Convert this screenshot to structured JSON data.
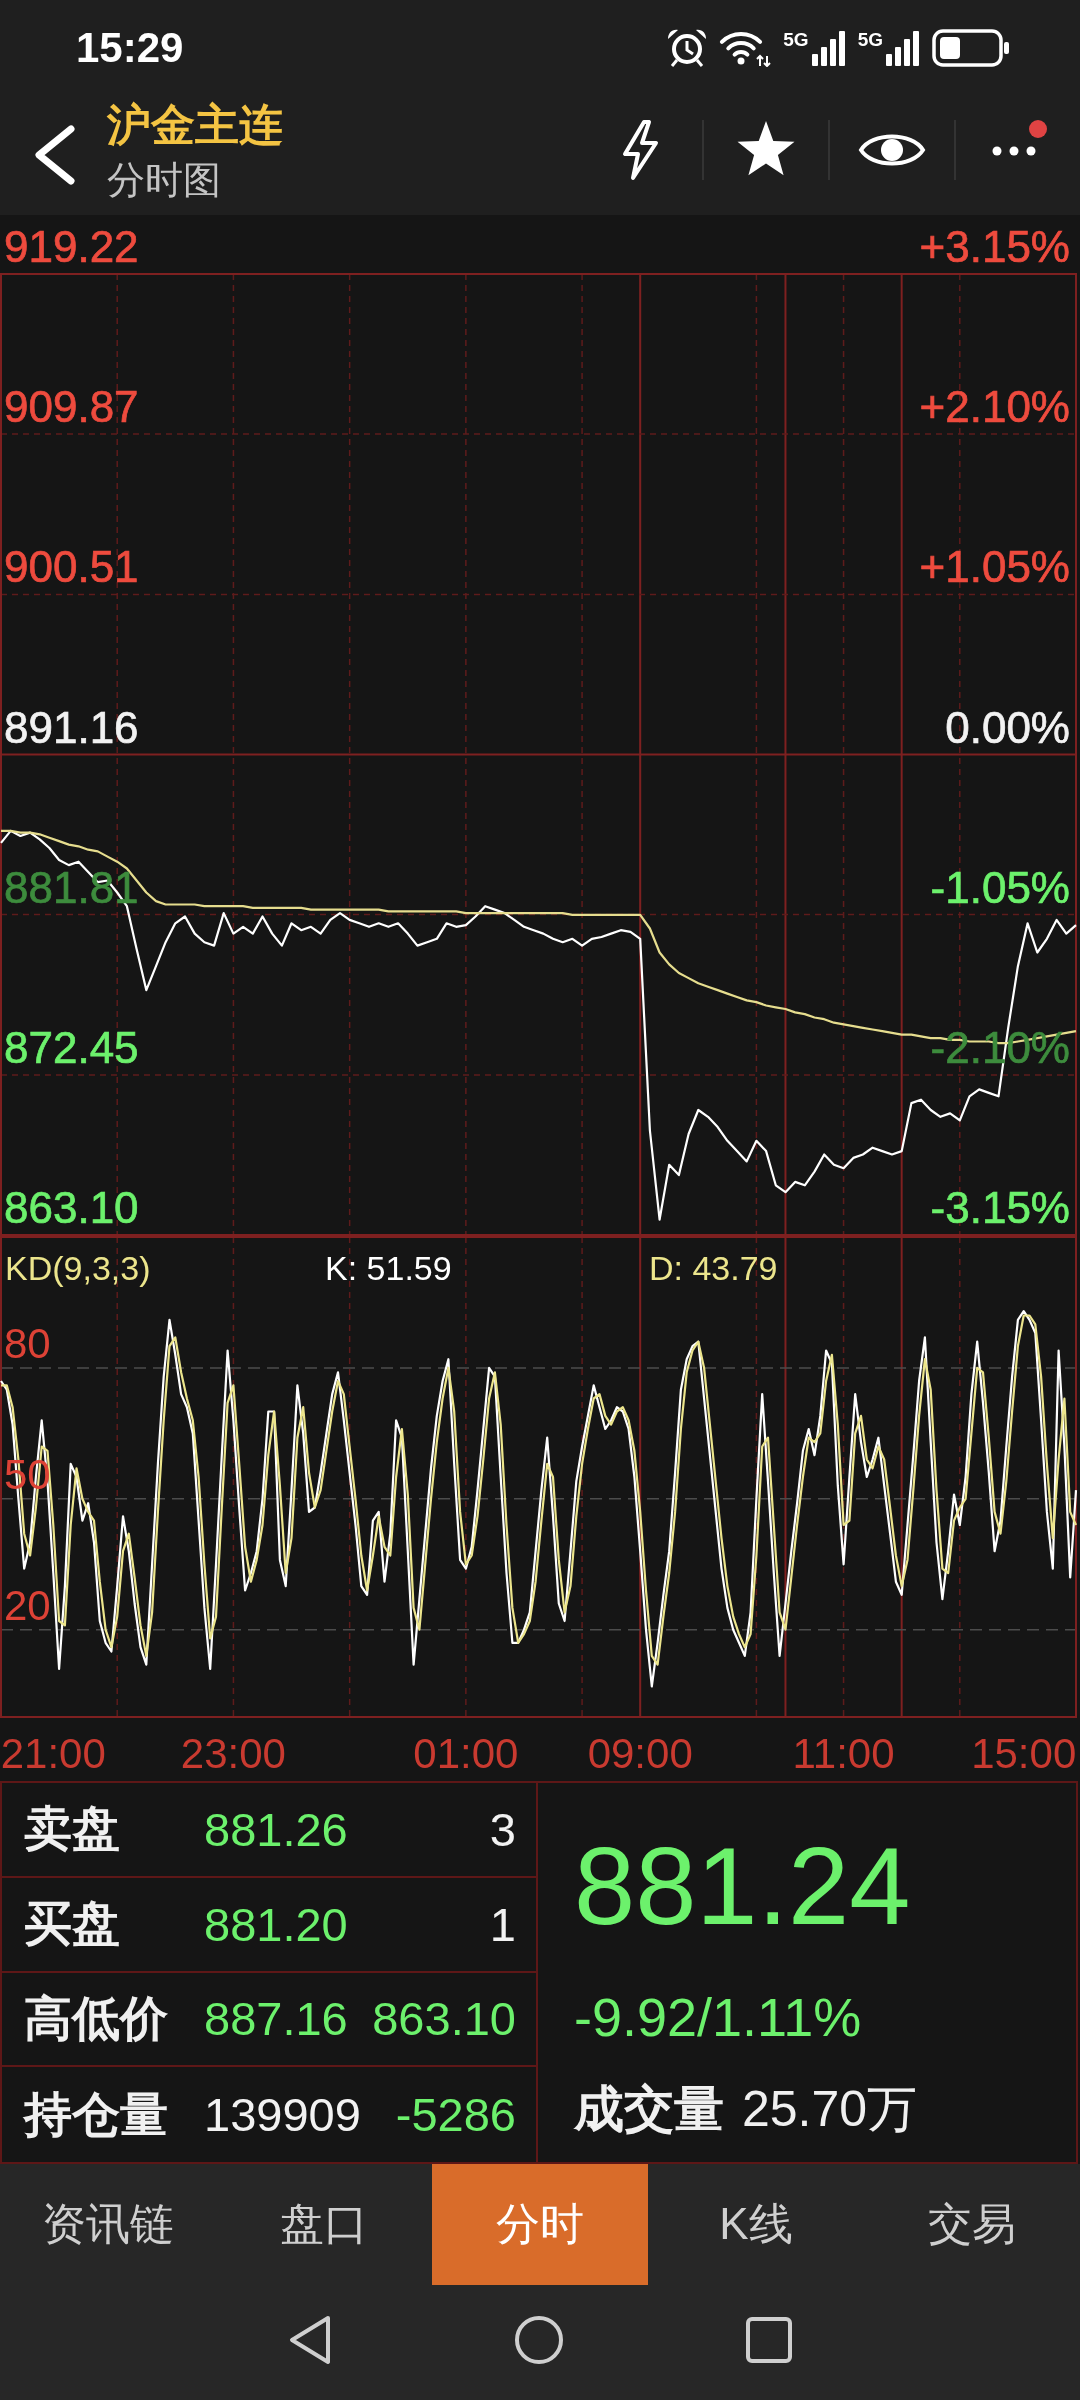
{
  "status_bar": {
    "time": "15:29",
    "networks": [
      {
        "label": "5G"
      },
      {
        "label": "5G"
      }
    ]
  },
  "header": {
    "title": "沪金主连",
    "subtitle": "分时图",
    "more_badge": true
  },
  "price_chart": {
    "scale": [
      {
        "left": {
          "color": "#ee4b3e"
        },
        "right": {
          "text": "+3.15%",
          "color": "#ee4b3e"
        }
      },
      {
        "left": {
          "color": "#ee4b3e"
        },
        "right": {
          "text": "+2.10%",
          "color": "#ee4b3e"
        }
      },
      {
        "left": {
          "color": "#ee4b3e"
        },
        "right": {
          "text": "+1.05%",
          "color": "#ee4b3e"
        }
      },
      {
        "left": {
          "color": "#f2f2f2"
        },
        "right": {
          "text": "0.00%",
          "color": "#f2f2f2"
        }
      },
      {
        "left": {
          "color": "#3d8c3d"
        },
        "right": {
          "text": "-1.05%",
          "color": "#6cf16c"
        }
      },
      {
        "left": {
          "color": "#6cf16c"
        },
        "right": {
          "text": "-2.10%",
          "color": "#3d8c3d"
        }
      },
      {
        "left": {
          "color": "#6cf16c"
        },
        "right": {
          "text": "-3.15%",
          "color": "#6cf16c"
        }
      }
    ],
    "chart_data": {
      "type": "line",
      "grid": true,
      "ylim": [
        863.1,
        919.22
      ],
      "yticks": [
        {
          "value": 919.22,
          "label": "919.22"
        },
        {
          "value": 909.87,
          "label": "909.87"
        },
        {
          "value": 900.51,
          "label": "900.51"
        },
        {
          "value": 891.16,
          "label": "891.16"
        },
        {
          "value": 881.81,
          "label": "881.81"
        },
        {
          "value": 872.45,
          "label": "872.45"
        },
        {
          "value": 863.1,
          "label": "863.10"
        }
      ],
      "categories": [
        null,
        null,
        null,
        null,
        null,
        null,
        null,
        null,
        null,
        null,
        null,
        null,
        null,
        null,
        null,
        null,
        null,
        null,
        null,
        null,
        null,
        null,
        null,
        null,
        null,
        null,
        null,
        null,
        null,
        null,
        null,
        null,
        null,
        null,
        null,
        null,
        null,
        null,
        null,
        null,
        null,
        null,
        null,
        null,
        null,
        null,
        null,
        null,
        null,
        null,
        null,
        null,
        null,
        null,
        null,
        null,
        null,
        null,
        null,
        null,
        null,
        null,
        null,
        null,
        null,
        null,
        null,
        null,
        null,
        null,
        null,
        null,
        null,
        null,
        null,
        null,
        null,
        null,
        null,
        null,
        null,
        null,
        null,
        null,
        null,
        null,
        null,
        null,
        null,
        null,
        null,
        null,
        null,
        null,
        null,
        null,
        null,
        null,
        null,
        null,
        null,
        null,
        null,
        null,
        null,
        null,
        null,
        null,
        null,
        null,
        null,
        null
      ],
      "series": [
        {
          "color": "#ffffff",
          "values": [
            886.0,
            886.7,
            886.4,
            886.6,
            886.2,
            885.7,
            885.0,
            884.7,
            884.9,
            884.3,
            883.7,
            883.8,
            883.1,
            882.3,
            879.8,
            877.4,
            878.8,
            880.2,
            881.3,
            881.7,
            880.7,
            880.2,
            880.0,
            881.9,
            880.7,
            881.1,
            880.7,
            881.7,
            880.7,
            880.0,
            881.3,
            880.9,
            881.1,
            880.7,
            881.5,
            881.9,
            881.5,
            881.3,
            881.1,
            881.3,
            881.1,
            881.3,
            880.7,
            880.0,
            880.2,
            880.4,
            881.3,
            881.1,
            881.2,
            881.7,
            882.3,
            882.1,
            881.9,
            881.5,
            881.1,
            880.9,
            880.7,
            880.4,
            880.2,
            880.4,
            880.0,
            880.4,
            880.5,
            880.7,
            880.9,
            880.8,
            880.4,
            869.2,
            864.0,
            867.2,
            866.6,
            869.0,
            870.4,
            870.0,
            869.4,
            868.6,
            868.0,
            867.4,
            868.6,
            868.0,
            866.0,
            865.6,
            866.2,
            866.0,
            866.8,
            867.8,
            867.2,
            867.0,
            867.6,
            867.8,
            868.2,
            868.0,
            867.8,
            868.0,
            870.8,
            871.0,
            870.4,
            870.0,
            870.2,
            869.8,
            871.2,
            871.6,
            871.4,
            871.2,
            875.2,
            878.8,
            881.3,
            879.6,
            880.4,
            881.5,
            880.7,
            881.2
          ]
        },
        {
          "color": "#e6dd8e",
          "values": [
            886.7,
            886.7,
            886.6,
            886.6,
            886.5,
            886.3,
            886.1,
            885.9,
            885.8,
            885.6,
            885.5,
            885.2,
            884.9,
            884.5,
            883.8,
            883.1,
            882.6,
            882.4,
            882.4,
            882.4,
            882.4,
            882.3,
            882.3,
            882.3,
            882.3,
            882.3,
            882.2,
            882.2,
            882.2,
            882.2,
            882.2,
            882.2,
            882.1,
            882.1,
            882.1,
            882.1,
            882.1,
            882.1,
            882.1,
            882.1,
            882.0,
            882.0,
            882.0,
            882.0,
            882.0,
            882.0,
            882.0,
            882.0,
            881.9,
            881.9,
            881.9,
            881.9,
            881.9,
            881.9,
            881.9,
            881.9,
            881.9,
            881.9,
            881.9,
            881.8,
            881.8,
            881.8,
            881.8,
            881.8,
            881.8,
            881.8,
            881.8,
            881.0,
            879.6,
            878.9,
            878.4,
            878.1,
            877.8,
            877.6,
            877.4,
            877.2,
            877.0,
            876.8,
            876.7,
            876.5,
            876.4,
            876.3,
            876.1,
            876.0,
            875.8,
            875.7,
            875.5,
            875.4,
            875.3,
            875.2,
            875.1,
            875.0,
            874.9,
            874.8,
            874.8,
            874.7,
            874.6,
            874.6,
            874.5,
            874.5,
            874.4,
            874.4,
            874.4,
            874.3,
            874.3,
            874.4,
            874.5,
            874.6,
            874.7,
            874.8,
            874.9,
            875.0
          ]
        }
      ]
    }
  },
  "kd_chart": {
    "readings": [
      "K: 51.59",
      "D: 43.79"
    ],
    "chart_data": {
      "type": "line",
      "title": "KD(9,3,3)",
      "grid": true,
      "ylim": [
        0,
        110
      ],
      "yticks": [
        20,
        50,
        80
      ],
      "categories": [
        null,
        null,
        null,
        null,
        null,
        null,
        null,
        null,
        null,
        "21:00",
        null,
        null,
        null,
        null,
        null,
        null,
        null,
        null,
        null,
        null,
        null,
        null,
        null,
        null,
        null,
        null,
        null,
        null,
        null,
        null,
        null,
        null,
        null,
        null,
        null,
        null,
        null,
        null,
        null,
        null,
        "23:00",
        null,
        null,
        null,
        null,
        null,
        null,
        null,
        null,
        null,
        null,
        null,
        null,
        null,
        null,
        null,
        null,
        null,
        null,
        null,
        null,
        null,
        null,
        null,
        null,
        null,
        null,
        null,
        null,
        null,
        null,
        null,
        null,
        null,
        null,
        null,
        null,
        null,
        null,
        null,
        "01:00",
        null,
        null,
        null,
        null,
        null,
        null,
        null,
        null,
        null,
        null,
        null,
        null,
        null,
        null,
        null,
        null,
        null,
        null,
        null,
        null,
        null,
        null,
        null,
        null,
        null,
        null,
        null,
        null,
        null,
        "09:00",
        null,
        null,
        null,
        null,
        null,
        null,
        null,
        null,
        null,
        null,
        null,
        null,
        null,
        null,
        null,
        null,
        null,
        null,
        null,
        null,
        null,
        null,
        null,
        null,
        null,
        null,
        null,
        null,
        null,
        null,
        null,
        null,
        null,
        null,
        "11:00",
        null,
        null,
        null,
        null,
        null,
        null,
        null,
        null,
        null,
        null,
        null,
        null,
        null,
        null,
        null,
        null,
        null,
        null,
        null,
        null,
        null,
        null,
        null,
        null,
        null,
        null,
        null,
        null,
        null,
        null,
        "15:00",
        null,
        null,
        null,
        null,
        null,
        null,
        null,
        null,
        null
      ],
      "series": [
        {
          "color": "#ffffff",
          "values": [
            77,
            75,
            67,
            50,
            34,
            40,
            55,
            68,
            54,
            33,
            11,
            30,
            58,
            55,
            45,
            49,
            40,
            22,
            17,
            15,
            30,
            46,
            38,
            26,
            16,
            12,
            35,
            58,
            78,
            91,
            83,
            74,
            71,
            65,
            45,
            25,
            11,
            35,
            60,
            84,
            68,
            48,
            29,
            33,
            38,
            50,
            70,
            70,
            36,
            30,
            52,
            76,
            65,
            47,
            48,
            56,
            65,
            74,
            79,
            68,
            56,
            44,
            30,
            28,
            45,
            47,
            31,
            42,
            68,
            64,
            38,
            12,
            27,
            42,
            57,
            69,
            77,
            82,
            58,
            36,
            34,
            39,
            52,
            66,
            80,
            78,
            55,
            33,
            17,
            17,
            20,
            24,
            38,
            52,
            64,
            46,
            26,
            22,
            38,
            54,
            62,
            69,
            76,
            71,
            66,
            68,
            71,
            70,
            66,
            55,
            38,
            20,
            7,
            17,
            28,
            38,
            56,
            75,
            82,
            85,
            86,
            73,
            60,
            47,
            34,
            25,
            20,
            17,
            14,
            24,
            50,
            74,
            54,
            33,
            14,
            26,
            38,
            49,
            61,
            66,
            60,
            69,
            84,
            81,
            53,
            35,
            55,
            74,
            63,
            55,
            59,
            64,
            53,
            42,
            31,
            28,
            44,
            60,
            77,
            87,
            63,
            40,
            27,
            38,
            51,
            44,
            55,
            74,
            86,
            72,
            56,
            38,
            45,
            62,
            78,
            91,
            93,
            91,
            88,
            68,
            47,
            34,
            84,
            62,
            32,
            52
          ]
        },
        {
          "color": "#ece58c",
          "values": [
            76,
            76,
            71,
            59,
            42,
            37,
            48,
            62,
            61,
            44,
            22,
            21,
            44,
            57,
            50,
            47,
            45,
            31,
            20,
            16,
            23,
            38,
            42,
            32,
            21,
            14,
            24,
            47,
            68,
            85,
            87,
            79,
            73,
            68,
            55,
            35,
            18,
            23,
            48,
            72,
            76,
            58,
            39,
            31,
            36,
            44,
            60,
            70,
            53,
            33,
            41,
            64,
            71,
            56,
            48,
            52,
            61,
            70,
            77,
            74,
            62,
            50,
            37,
            29,
            37,
            46,
            39,
            37,
            55,
            66,
            51,
            25,
            20,
            35,
            50,
            63,
            73,
            80,
            70,
            47,
            35,
            37,
            46,
            59,
            73,
            79,
            67,
            44,
            25,
            17,
            19,
            22,
            31,
            45,
            58,
            55,
            36,
            24,
            30,
            46,
            58,
            66,
            73,
            74,
            69,
            67,
            70,
            71,
            68,
            61,
            47,
            29,
            14,
            12,
            23,
            33,
            47,
            66,
            79,
            84,
            86,
            80,
            67,
            54,
            41,
            30,
            23,
            19,
            16,
            19,
            37,
            62,
            64,
            44,
            24,
            20,
            32,
            44,
            55,
            64,
            63,
            65,
            77,
            83,
            67,
            44,
            45,
            65,
            69,
            59,
            57,
            62,
            59,
            48,
            37,
            30,
            36,
            52,
            69,
            82,
            75,
            52,
            34,
            33,
            45,
            48,
            50,
            65,
            80,
            79,
            64,
            47,
            42,
            54,
            70,
            85,
            92,
            92,
            90,
            78,
            58,
            41,
            59,
            73,
            47,
            44
          ]
        }
      ]
    }
  },
  "quote_panel": {
    "rows": [
      {
        "label": "卖盘",
        "cells": [
          {
            "text": "881.26",
            "color": "#6cf16c"
          },
          {
            "text": "3",
            "color": "#f2f2f2"
          }
        ]
      },
      {
        "label": "买盘",
        "cells": [
          {
            "text": "881.20",
            "color": "#6cf16c"
          },
          {
            "text": "1",
            "color": "#f2f2f2"
          }
        ]
      },
      {
        "label": "高低价",
        "cells": [
          {
            "text": "887.16",
            "color": "#6cf16c"
          },
          {
            "text": "863.10",
            "color": "#6cf16c"
          }
        ]
      },
      {
        "label": "持仓量",
        "cells": [
          {
            "text": "139909",
            "color": "#f2f2f2"
          },
          {
            "text": "-5286",
            "color": "#6cf16c"
          }
        ]
      }
    ],
    "last_price": "881.24",
    "change": "-9.92/1.11%",
    "volume": {
      "label": "成交量",
      "value": "25.70万"
    }
  },
  "tabs": [
    {
      "label": "资讯链",
      "selected": false
    },
    {
      "label": "盘口",
      "selected": false
    },
    {
      "label": "分时",
      "selected": true
    },
    {
      "label": "K线",
      "selected": false
    },
    {
      "label": "交易",
      "selected": false
    }
  ]
}
